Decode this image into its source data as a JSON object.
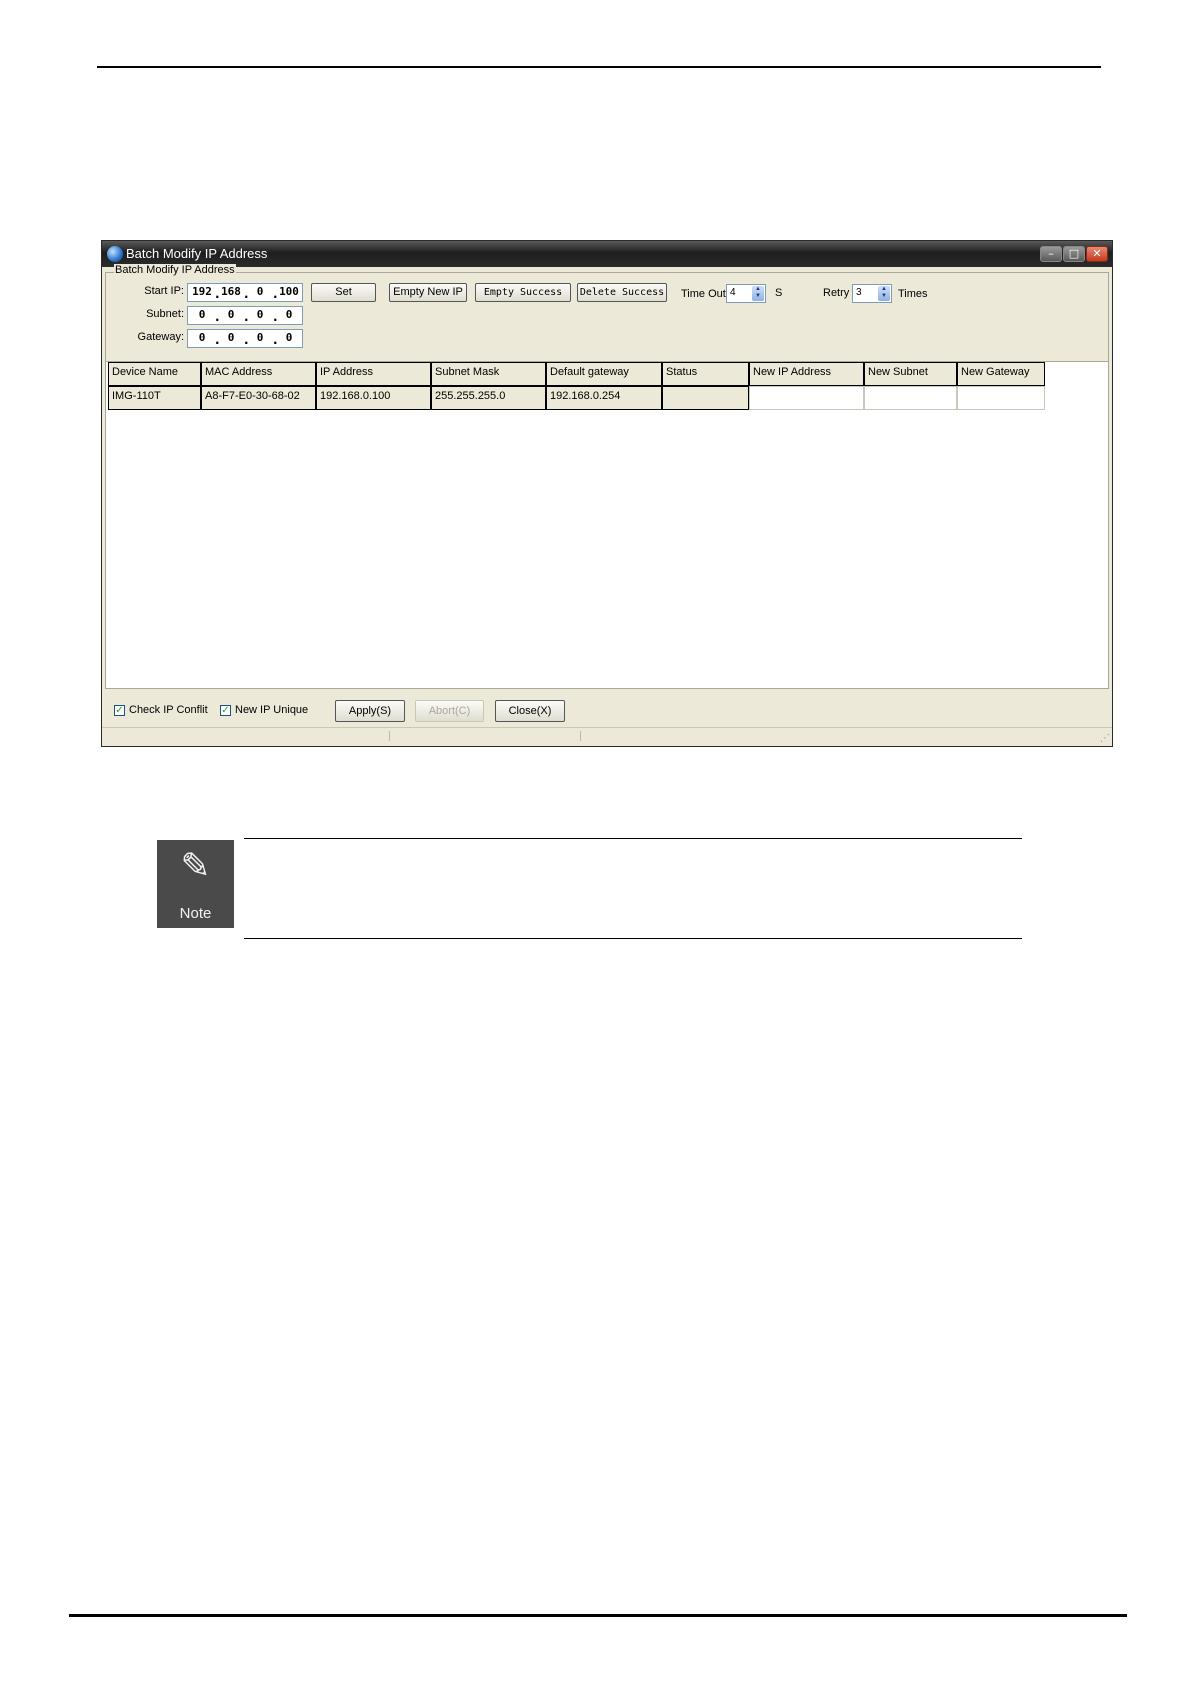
{
  "window": {
    "title": "Batch Modify IP Address",
    "controls": {
      "minimize": "–",
      "maximize": "□",
      "close": "✕"
    }
  },
  "form": {
    "group_title": "Batch Modify IP Address",
    "start_ip_label": "Start IP:",
    "start_ip": [
      "192",
      "168",
      "0",
      "100"
    ],
    "subnet_label": "Subnet:",
    "subnet": [
      "0",
      "0",
      "0",
      "0"
    ],
    "gateway_label": "Gateway:",
    "gateway": [
      "0",
      "0",
      "0",
      "0"
    ],
    "buttons": {
      "set": "Set",
      "empty_new_ip": "Empty New IP",
      "empty_success": "Empty Success",
      "delete_success": "Delete Success"
    },
    "timeout_label": "Time Out",
    "timeout_value": "4",
    "timeout_unit": "S",
    "retry_label": "Retry",
    "retry_value": "3",
    "retry_unit": "Times"
  },
  "table": {
    "headers": [
      "Device Name",
      "MAC Address",
      "IP Address",
      "Subnet Mask",
      "Default gateway",
      "Status",
      "New IP Address",
      "New Subnet",
      "New Gateway"
    ],
    "rows": [
      [
        "IMG-110T",
        "A8-F7-E0-30-68-02",
        "192.168.0.100",
        "255.255.255.0",
        "192.168.0.254",
        "",
        "",
        "",
        ""
      ]
    ]
  },
  "bottom": {
    "check_ip_conflict": "Check IP Conflit",
    "new_ip_unique": "New IP Unique",
    "apply": "Apply(S)",
    "abort": "Abort(C)",
    "close": "Close(X)"
  },
  "note": {
    "icon": "note-pencil-icon",
    "label": "Note"
  }
}
